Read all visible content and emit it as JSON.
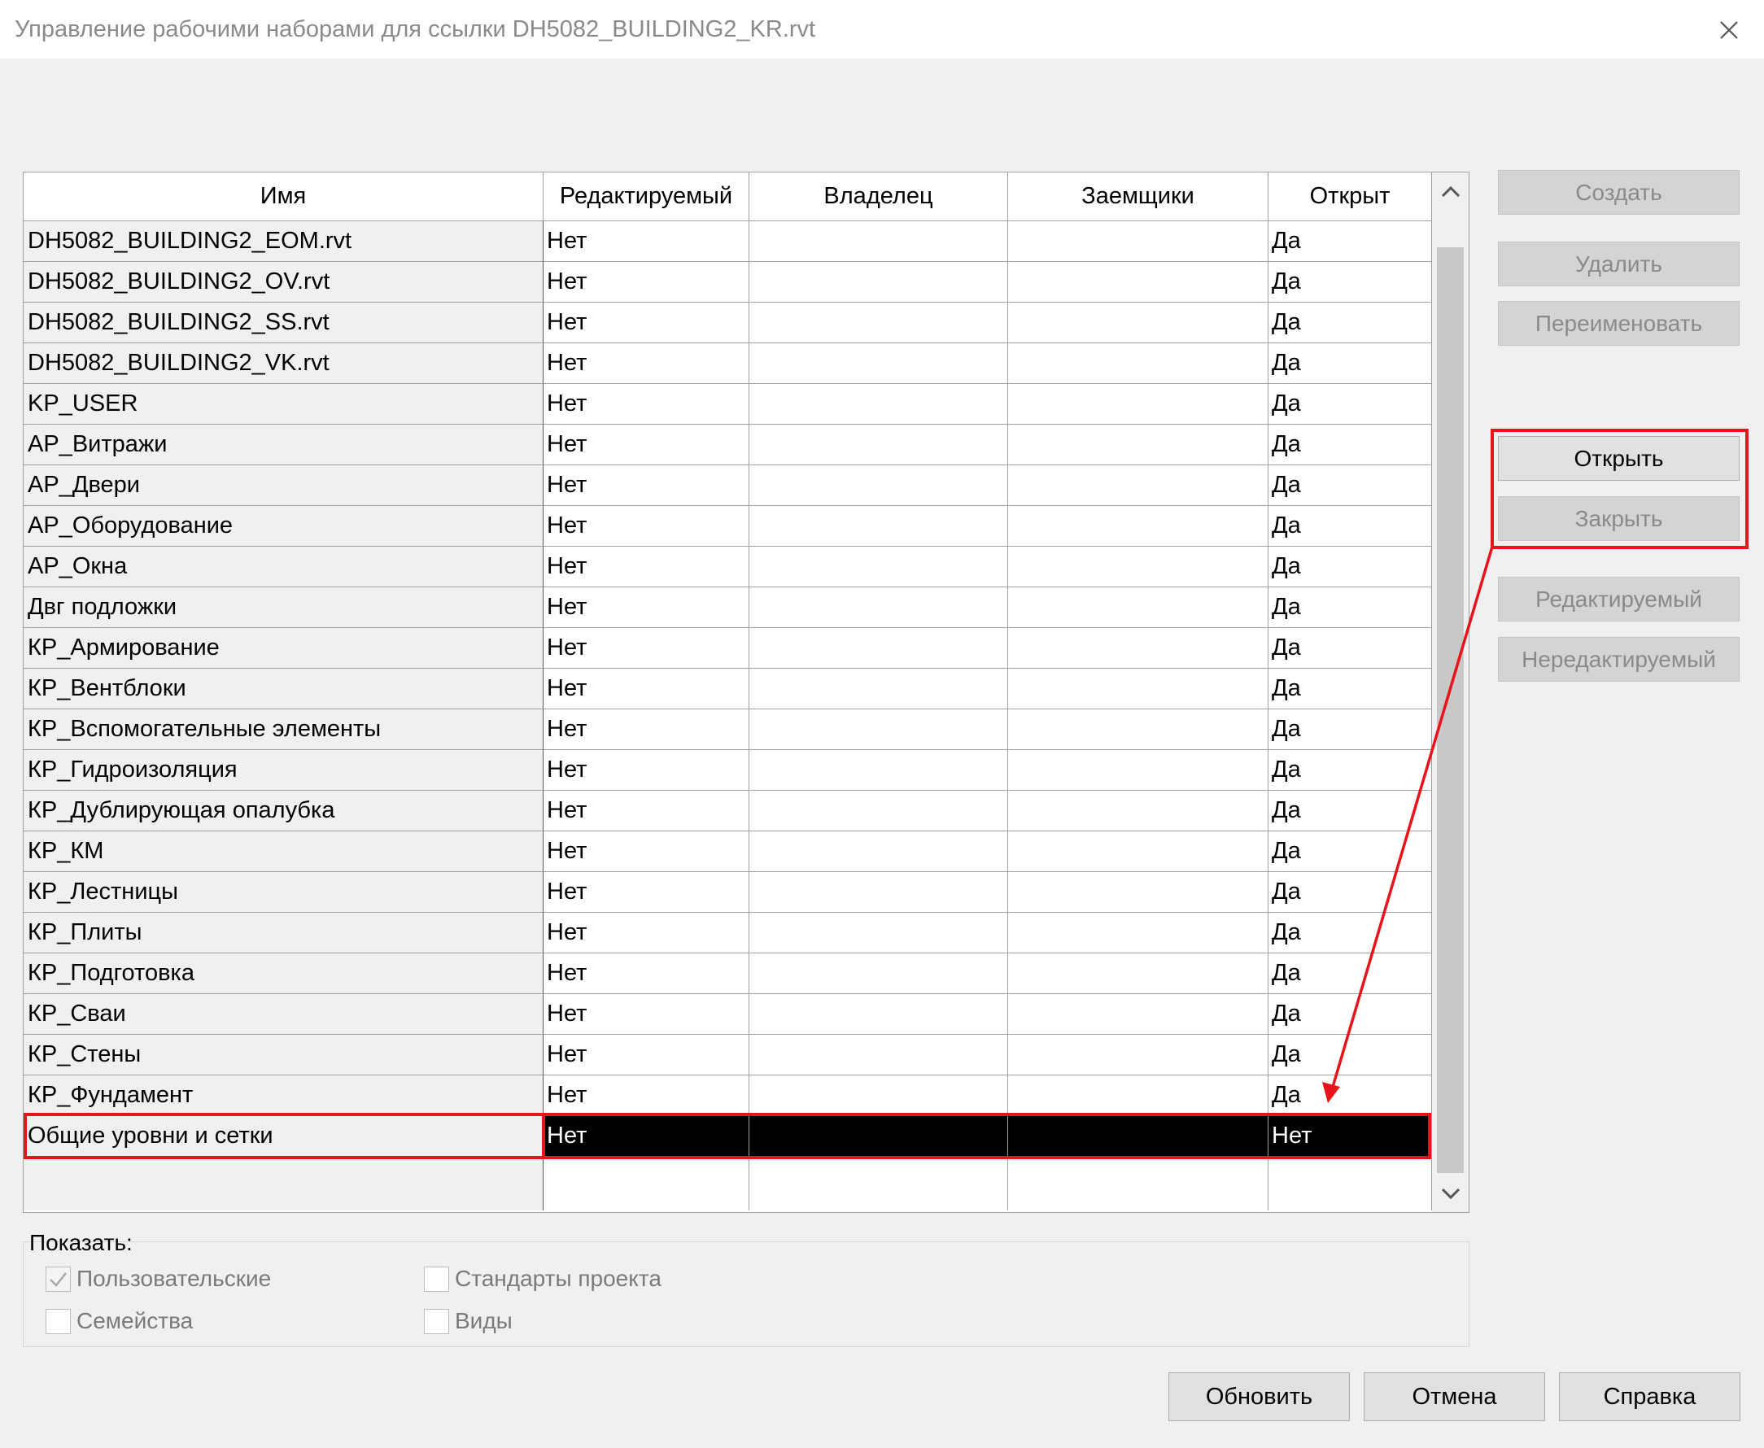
{
  "window": {
    "title": "Управление рабочими наборами для ссылки DH5082_BUILDING2_KR.rvt"
  },
  "table": {
    "columns": [
      "Имя",
      "Редактируемый",
      "Владелец",
      "Заемщики",
      "Открыт"
    ],
    "rows": [
      {
        "name": "DH5082_BUILDING2_EOM.rvt",
        "editable": "Нет",
        "owner": "",
        "borrowers": "",
        "open": "Да"
      },
      {
        "name": "DH5082_BUILDING2_OV.rvt",
        "editable": "Нет",
        "owner": "",
        "borrowers": "",
        "open": "Да"
      },
      {
        "name": "DH5082_BUILDING2_SS.rvt",
        "editable": "Нет",
        "owner": "",
        "borrowers": "",
        "open": "Да"
      },
      {
        "name": "DH5082_BUILDING2_VK.rvt",
        "editable": "Нет",
        "owner": "",
        "borrowers": "",
        "open": "Да"
      },
      {
        "name": "KP_USER",
        "editable": "Нет",
        "owner": "",
        "borrowers": "",
        "open": "Да"
      },
      {
        "name": "АР_Витражи",
        "editable": "Нет",
        "owner": "",
        "borrowers": "",
        "open": "Да"
      },
      {
        "name": "АР_Двери",
        "editable": "Нет",
        "owner": "",
        "borrowers": "",
        "open": "Да"
      },
      {
        "name": "АР_Оборудование",
        "editable": "Нет",
        "owner": "",
        "borrowers": "",
        "open": "Да"
      },
      {
        "name": "АР_Окна",
        "editable": "Нет",
        "owner": "",
        "borrowers": "",
        "open": "Да"
      },
      {
        "name": "Двг подложки",
        "editable": "Нет",
        "owner": "",
        "borrowers": "",
        "open": "Да"
      },
      {
        "name": "КР_Армирование",
        "editable": "Нет",
        "owner": "",
        "borrowers": "",
        "open": "Да"
      },
      {
        "name": "КР_Вентблоки",
        "editable": "Нет",
        "owner": "",
        "borrowers": "",
        "open": "Да"
      },
      {
        "name": "КР_Вспомогательные элементы",
        "editable": "Нет",
        "owner": "",
        "borrowers": "",
        "open": "Да"
      },
      {
        "name": "КР_Гидроизоляция",
        "editable": "Нет",
        "owner": "",
        "borrowers": "",
        "open": "Да"
      },
      {
        "name": "КР_Дублирующая опалубка",
        "editable": "Нет",
        "owner": "",
        "borrowers": "",
        "open": "Да"
      },
      {
        "name": "КР_КМ",
        "editable": "Нет",
        "owner": "",
        "borrowers": "",
        "open": "Да"
      },
      {
        "name": "КР_Лестницы",
        "editable": "Нет",
        "owner": "",
        "borrowers": "",
        "open": "Да"
      },
      {
        "name": "КР_Плиты",
        "editable": "Нет",
        "owner": "",
        "borrowers": "",
        "open": "Да"
      },
      {
        "name": "КР_Подготовка",
        "editable": "Нет",
        "owner": "",
        "borrowers": "",
        "open": "Да"
      },
      {
        "name": "КР_Сваи",
        "editable": "Нет",
        "owner": "",
        "borrowers": "",
        "open": "Да"
      },
      {
        "name": "КР_Стены",
        "editable": "Нет",
        "owner": "",
        "borrowers": "",
        "open": "Да"
      },
      {
        "name": "КР_Фундамент",
        "editable": "Нет",
        "owner": "",
        "borrowers": "",
        "open": "Да"
      },
      {
        "name": "Общие уровни и сетки",
        "editable": "Нет",
        "owner": "",
        "borrowers": "",
        "open": "Нет",
        "selected": true
      }
    ]
  },
  "side_buttons": {
    "create": "Создать",
    "delete": "Удалить",
    "rename": "Переименовать",
    "open": "Открыть",
    "close": "Закрыть",
    "editable": "Редактируемый",
    "non_editable": "Нередактируемый"
  },
  "show": {
    "label": "Показать:",
    "user": {
      "label": "Пользовательские",
      "checked": true
    },
    "project_standards": {
      "label": "Стандарты проекта",
      "checked": false
    },
    "families": {
      "label": "Семейства",
      "checked": false
    },
    "views": {
      "label": "Виды",
      "checked": false
    }
  },
  "footer_buttons": {
    "refresh": "Обновить",
    "cancel": "Отмена",
    "help": "Справка"
  },
  "colors": {
    "annotation": "#e8141c",
    "selection_bg": "#000000",
    "window_bg": "#f0f0f0"
  },
  "icons": {
    "close": "close-icon",
    "scroll_up": "chevron-up-icon",
    "scroll_down": "chevron-down-icon",
    "checkmark": "checkmark-icon"
  }
}
